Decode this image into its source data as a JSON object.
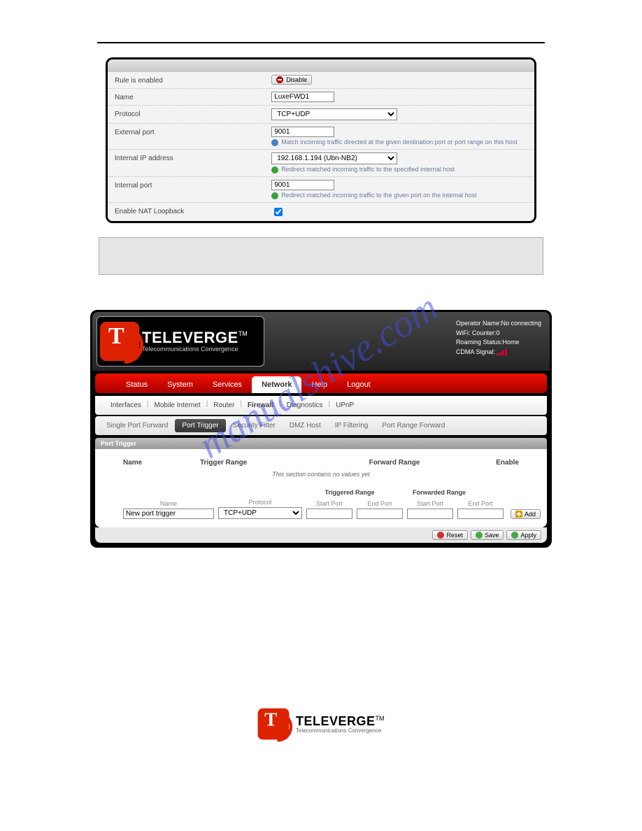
{
  "form": {
    "rule_enabled_label": "Rule is enabled",
    "disable_btn": "Disable",
    "name_label": "Name",
    "name_value": "LuxeFWD1",
    "protocol_label": "Protocol",
    "protocol_value": "TCP+UDP",
    "external_port_label": "External port",
    "external_port_value": "9001",
    "external_port_hint": "Match incoming traffic directed at the given destination port or port range on this host",
    "internal_ip_label": "Internal IP address",
    "internal_ip_value": "192.168.1.194 (Ubn-NB2)",
    "internal_ip_hint": "Redirect matched incoming traffic to the specified internal host",
    "internal_port_label": "Internal port",
    "internal_port_value": "9001",
    "internal_port_hint": "Redirect matched incoming traffic to the given port on the internal host",
    "nat_loopback_label": "Enable NAT Loopback"
  },
  "router": {
    "brand": "TELEVERGE",
    "tm": "TM",
    "tagline": "Telecommunications Convergence",
    "status": {
      "operator": "Operator Name:No connecting",
      "wifi": "WiFi: Counter:0",
      "roaming": "Roaming Status:Home",
      "signal": "CDMA Signal:"
    },
    "nav": [
      "Status",
      "System",
      "Services",
      "Network",
      "Help",
      "Logout"
    ],
    "nav_active": 3,
    "subnav": [
      "Interfaces",
      "Mobile Internet",
      "Router",
      "Firewall",
      "Diagnostics",
      "UPnP"
    ],
    "subnav_active": 3,
    "subnav2": [
      "Single Port Forward",
      "Port Trigger",
      "Security Filter",
      "DMZ Host",
      "IP Filtering",
      "Port Range Forward"
    ],
    "subnav2_active": 1,
    "section_title": "Port Trigger",
    "cols": {
      "name": "Name",
      "trigger": "Trigger Range",
      "forward": "Forward Range",
      "enable": "Enable"
    },
    "empty": "This section contains no values yet",
    "range_hdr": {
      "triggered": "Triggered Range",
      "forwarded": "Forwarded Range"
    },
    "add": {
      "name_label": "Name",
      "name_ph": "New port trigger",
      "proto_label": "Protocol",
      "proto_value": "TCP+UDP",
      "start": "Start Port",
      "end": "End Port",
      "add_btn": "Add"
    },
    "buttons": {
      "reset": "Reset",
      "save": "Save",
      "apply": "Apply"
    }
  },
  "watermark": "manualshive.com"
}
